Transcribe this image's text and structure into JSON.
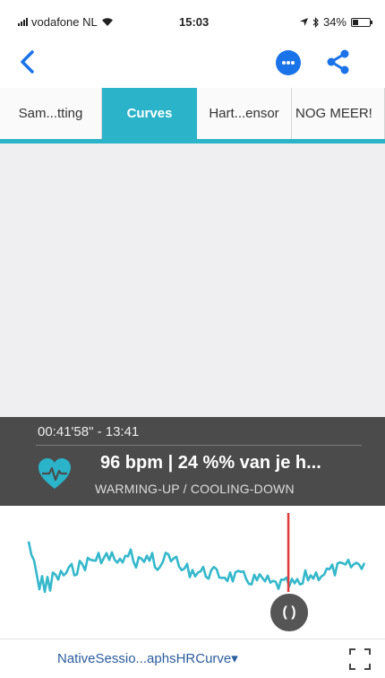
{
  "status_bar": {
    "carrier": "vodafone NL",
    "time": "15:03",
    "battery": "34%",
    "battery_level": 0.34
  },
  "nav": {
    "back_icon": "chevron-left-icon",
    "more_icon": "more-horizontal-icon",
    "share_icon": "share-icon"
  },
  "tabs": [
    {
      "label": "Sam...tting",
      "active": false
    },
    {
      "label": "Curves",
      "active": true
    },
    {
      "label": "Hart...ensor",
      "active": false
    },
    {
      "label": "NOG MEER!",
      "active": false
    }
  ],
  "info": {
    "time_range": "00:41'58\" - 13:41",
    "value": "96 bpm | 24 %% van je h...",
    "zone": "WARMING-UP / COOLING-DOWN",
    "icon": "heart-rate-icon"
  },
  "scrubber": {
    "label": "( )",
    "position": 0.749
  },
  "footer": {
    "graph_label": "NativeSessio...aphsHRCurve▾",
    "expand_icon": "expand-icon"
  },
  "colors": {
    "accent": "#2ab3c9",
    "line": "#35b8cb",
    "marker": "#e03a3a",
    "panel": "#4b4b4b",
    "link": "#2b5c9e"
  }
}
